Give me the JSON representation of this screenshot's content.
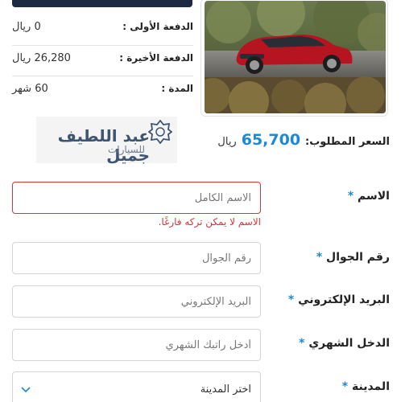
{
  "payments": {
    "first": {
      "label": "الدفعة الأولى :",
      "value": "0 ريال"
    },
    "last": {
      "label": "الدفعة الأخيرة :",
      "value": "26,280 ريال"
    },
    "term": {
      "label": "المدة :",
      "value": "60 شهر"
    }
  },
  "price": {
    "label": "السعر المطلوب:",
    "value": "65,700",
    "currency": "ريال"
  },
  "logo": {
    "name": "عبد اللطيف جميل",
    "sub": "للسيارات",
    "color": "#3d5570"
  },
  "form": {
    "name": {
      "label": "الاسم",
      "placeholder": "الاسم الكامل",
      "error": "الاسم لا يمكن تركه فارغًا."
    },
    "mobile": {
      "label": "رقم الجوال",
      "placeholder": "رقم الجوال"
    },
    "email": {
      "label": "البريد الإلكتروني",
      "placeholder": "البريد الإلكتروني"
    },
    "income": {
      "label": "الدخل الشهري",
      "placeholder": "أدخل راتبك الشهري"
    },
    "city": {
      "label": "المدينة",
      "selected": "اختر المدينة"
    },
    "required_mark": "*"
  },
  "colors": {
    "accent": "#1e88d8",
    "error": "#d9343b",
    "dark": "#1e2a44"
  }
}
